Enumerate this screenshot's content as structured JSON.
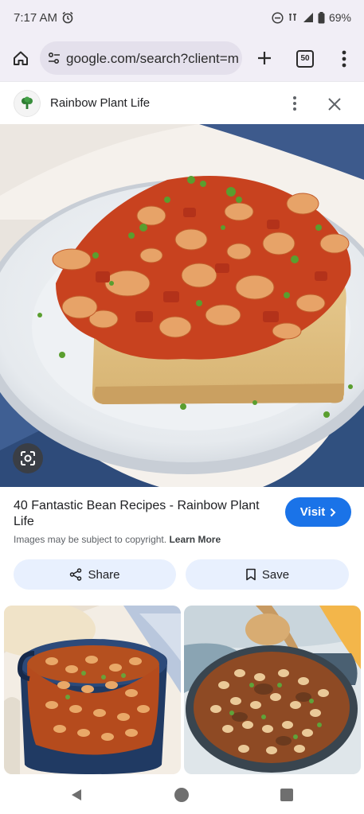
{
  "status": {
    "time": "7:17 AM",
    "battery": "69%",
    "icons": [
      "alarm-icon",
      "do-not-disturb-icon",
      "lte-signal-icon",
      "cell-signal-icon",
      "battery-icon"
    ]
  },
  "browser": {
    "url": "google.com/search?client=m",
    "tab_count": "50",
    "icons": [
      "home-icon",
      "tune-icon",
      "plus-icon",
      "tabs-icon",
      "menu-icon"
    ]
  },
  "source": {
    "site_name": "Rainbow Plant Life",
    "icons": [
      "broccoli-favicon-icon",
      "more-vert-icon",
      "close-icon"
    ]
  },
  "result": {
    "title": "40 Fantastic Bean Recipes - Rainbow Plant Life",
    "visit_label": "Visit",
    "copyright_text": "Images may be subject to copyright.",
    "learn_more": "Learn More",
    "share_label": "Share",
    "save_label": "Save"
  },
  "colors": {
    "accent": "#1a73e8",
    "chip_bg": "#e8f0fe",
    "browser_bg": "#f1eef6"
  }
}
